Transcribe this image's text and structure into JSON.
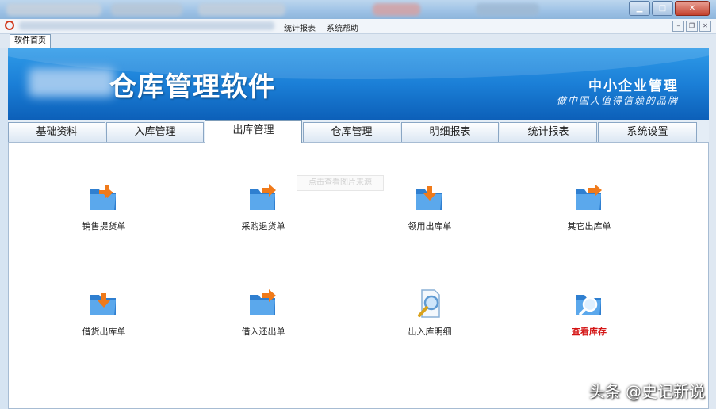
{
  "menu": {
    "items": [
      "统计报表",
      "系统帮助"
    ]
  },
  "doc_tab": {
    "label": "软件首页"
  },
  "banner": {
    "title": "仓库管理软件",
    "slogan_main": "中小企业管理",
    "slogan_sub": "做中国人值得信赖的品牌"
  },
  "tabs": [
    "基础资料",
    "入库管理",
    "出库管理",
    "仓库管理",
    "明细报表",
    "统计报表",
    "系统设置"
  ],
  "active_tab": "出库管理",
  "functions": [
    {
      "label": "销售提货单",
      "icon": "folder-arrow-icon"
    },
    {
      "label": "采购退货单",
      "icon": "folder-arrow-icon"
    },
    {
      "label": "领用出库单",
      "icon": "folder-arrow-icon"
    },
    {
      "label": "其它出库单",
      "icon": "folder-arrow-icon"
    },
    {
      "label": "借货出库单",
      "icon": "folder-arrow-icon"
    },
    {
      "label": "借入还出单",
      "icon": "folder-arrow-icon"
    },
    {
      "label": "出入库明细",
      "icon": "document-magnifier-icon"
    },
    {
      "label": "查看库存",
      "icon": "folder-magnifier-icon"
    }
  ],
  "overlay_hint": "点击查看图片来源",
  "watermark": "头条 @史记新说",
  "colors": {
    "banner": "#1b7fd7",
    "highlight_label": "#d41515",
    "arrow": "#f07a1a",
    "folder": "#3f8fd8"
  }
}
